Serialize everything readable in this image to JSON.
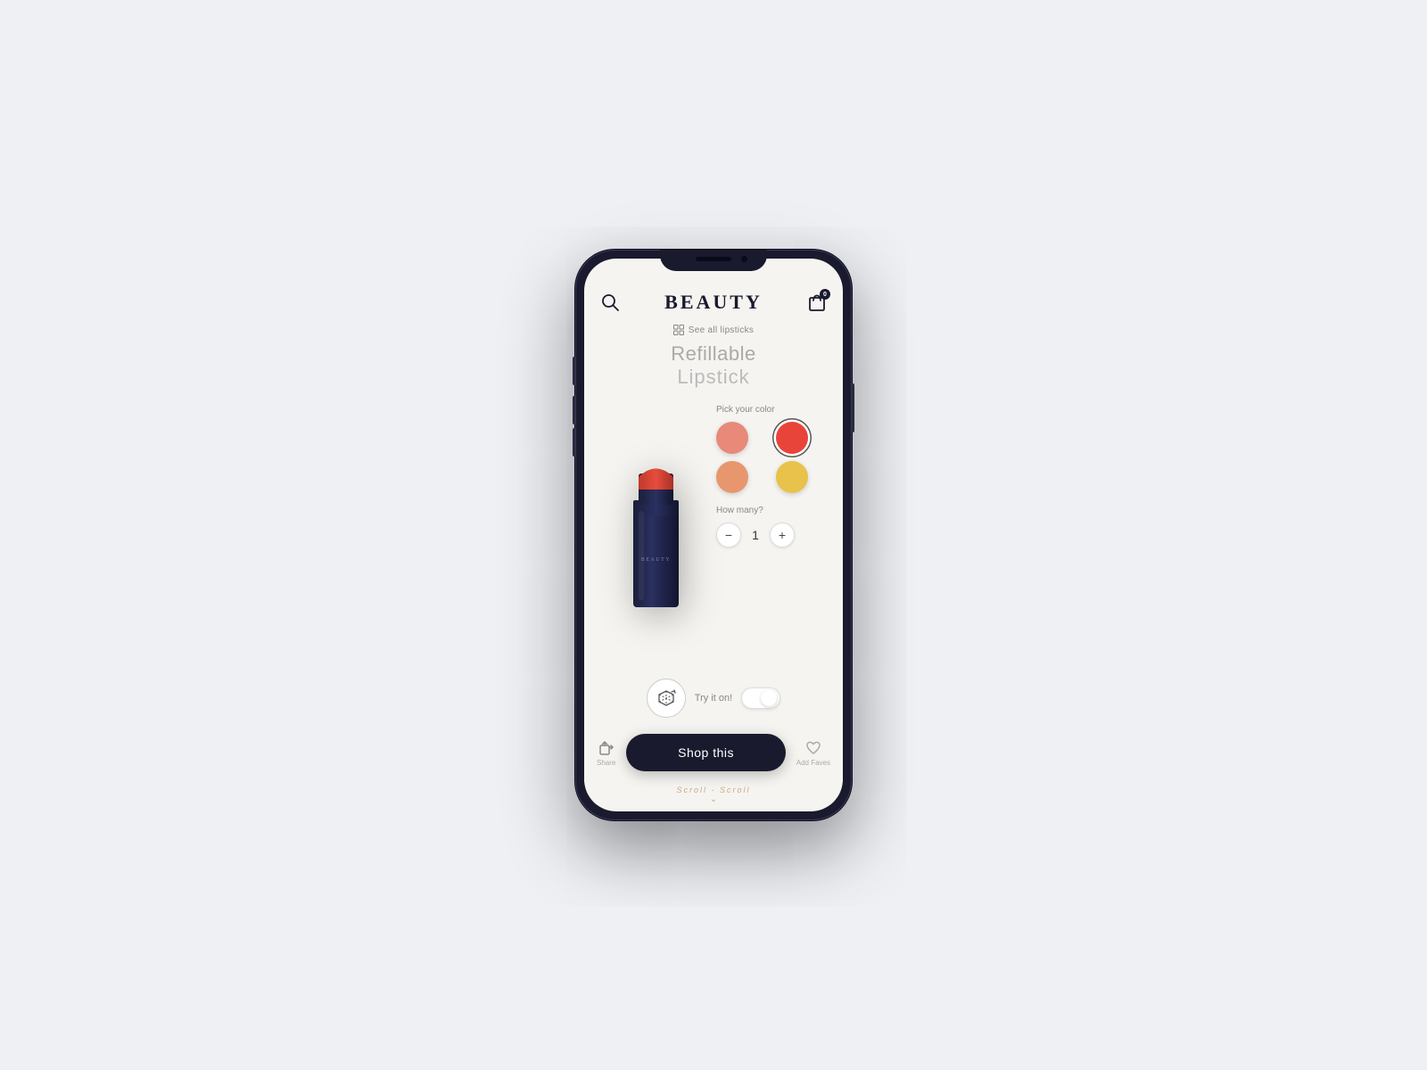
{
  "app": {
    "title": "BEAUTY",
    "background_color": "#eef0f4",
    "screen_bg": "#f5f4f0"
  },
  "header": {
    "title": "BEAUTY",
    "cart_count": "0"
  },
  "see_all": {
    "label": "See all lipsticks"
  },
  "product": {
    "title_line1": "Refillable",
    "title_line2": "Lipstick",
    "brand_label": "BEAUTY"
  },
  "color_picker": {
    "label": "Pick your color",
    "colors": [
      {
        "id": "blush",
        "value": "#e8897a",
        "selected": false
      },
      {
        "id": "red",
        "value": "#e8443a",
        "selected": true
      },
      {
        "id": "peach",
        "value": "#e8966e",
        "selected": false
      },
      {
        "id": "gold",
        "value": "#e8c24a",
        "selected": false
      }
    ]
  },
  "quantity": {
    "label": "How many?",
    "value": "1",
    "minus_label": "−",
    "plus_label": "+"
  },
  "try_on": {
    "label": "Try it on!"
  },
  "actions": {
    "share_label": "Share",
    "shop_label": "Shop this",
    "faves_label": "Add Faves"
  },
  "scroll": {
    "text": "Scroll - Scroll"
  }
}
